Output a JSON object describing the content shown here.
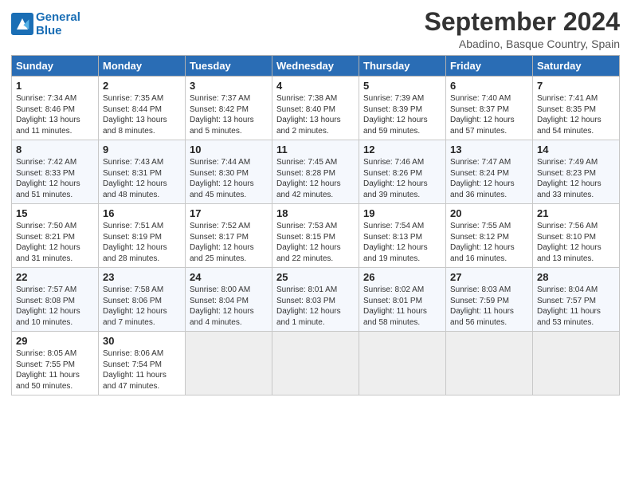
{
  "logo": {
    "line1": "General",
    "line2": "Blue"
  },
  "title": "September 2024",
  "location": "Abadino, Basque Country, Spain",
  "headers": [
    "Sunday",
    "Monday",
    "Tuesday",
    "Wednesday",
    "Thursday",
    "Friday",
    "Saturday"
  ],
  "weeks": [
    [
      {
        "num": "1",
        "info": "Sunrise: 7:34 AM\nSunset: 8:46 PM\nDaylight: 13 hours\nand 11 minutes."
      },
      {
        "num": "2",
        "info": "Sunrise: 7:35 AM\nSunset: 8:44 PM\nDaylight: 13 hours\nand 8 minutes."
      },
      {
        "num": "3",
        "info": "Sunrise: 7:37 AM\nSunset: 8:42 PM\nDaylight: 13 hours\nand 5 minutes."
      },
      {
        "num": "4",
        "info": "Sunrise: 7:38 AM\nSunset: 8:40 PM\nDaylight: 13 hours\nand 2 minutes."
      },
      {
        "num": "5",
        "info": "Sunrise: 7:39 AM\nSunset: 8:39 PM\nDaylight: 12 hours\nand 59 minutes."
      },
      {
        "num": "6",
        "info": "Sunrise: 7:40 AM\nSunset: 8:37 PM\nDaylight: 12 hours\nand 57 minutes."
      },
      {
        "num": "7",
        "info": "Sunrise: 7:41 AM\nSunset: 8:35 PM\nDaylight: 12 hours\nand 54 minutes."
      }
    ],
    [
      {
        "num": "8",
        "info": "Sunrise: 7:42 AM\nSunset: 8:33 PM\nDaylight: 12 hours\nand 51 minutes."
      },
      {
        "num": "9",
        "info": "Sunrise: 7:43 AM\nSunset: 8:31 PM\nDaylight: 12 hours\nand 48 minutes."
      },
      {
        "num": "10",
        "info": "Sunrise: 7:44 AM\nSunset: 8:30 PM\nDaylight: 12 hours\nand 45 minutes."
      },
      {
        "num": "11",
        "info": "Sunrise: 7:45 AM\nSunset: 8:28 PM\nDaylight: 12 hours\nand 42 minutes."
      },
      {
        "num": "12",
        "info": "Sunrise: 7:46 AM\nSunset: 8:26 PM\nDaylight: 12 hours\nand 39 minutes."
      },
      {
        "num": "13",
        "info": "Sunrise: 7:47 AM\nSunset: 8:24 PM\nDaylight: 12 hours\nand 36 minutes."
      },
      {
        "num": "14",
        "info": "Sunrise: 7:49 AM\nSunset: 8:23 PM\nDaylight: 12 hours\nand 33 minutes."
      }
    ],
    [
      {
        "num": "15",
        "info": "Sunrise: 7:50 AM\nSunset: 8:21 PM\nDaylight: 12 hours\nand 31 minutes."
      },
      {
        "num": "16",
        "info": "Sunrise: 7:51 AM\nSunset: 8:19 PM\nDaylight: 12 hours\nand 28 minutes."
      },
      {
        "num": "17",
        "info": "Sunrise: 7:52 AM\nSunset: 8:17 PM\nDaylight: 12 hours\nand 25 minutes."
      },
      {
        "num": "18",
        "info": "Sunrise: 7:53 AM\nSunset: 8:15 PM\nDaylight: 12 hours\nand 22 minutes."
      },
      {
        "num": "19",
        "info": "Sunrise: 7:54 AM\nSunset: 8:13 PM\nDaylight: 12 hours\nand 19 minutes."
      },
      {
        "num": "20",
        "info": "Sunrise: 7:55 AM\nSunset: 8:12 PM\nDaylight: 12 hours\nand 16 minutes."
      },
      {
        "num": "21",
        "info": "Sunrise: 7:56 AM\nSunset: 8:10 PM\nDaylight: 12 hours\nand 13 minutes."
      }
    ],
    [
      {
        "num": "22",
        "info": "Sunrise: 7:57 AM\nSunset: 8:08 PM\nDaylight: 12 hours\nand 10 minutes."
      },
      {
        "num": "23",
        "info": "Sunrise: 7:58 AM\nSunset: 8:06 PM\nDaylight: 12 hours\nand 7 minutes."
      },
      {
        "num": "24",
        "info": "Sunrise: 8:00 AM\nSunset: 8:04 PM\nDaylight: 12 hours\nand 4 minutes."
      },
      {
        "num": "25",
        "info": "Sunrise: 8:01 AM\nSunset: 8:03 PM\nDaylight: 12 hours\nand 1 minute."
      },
      {
        "num": "26",
        "info": "Sunrise: 8:02 AM\nSunset: 8:01 PM\nDaylight: 11 hours\nand 58 minutes."
      },
      {
        "num": "27",
        "info": "Sunrise: 8:03 AM\nSunset: 7:59 PM\nDaylight: 11 hours\nand 56 minutes."
      },
      {
        "num": "28",
        "info": "Sunrise: 8:04 AM\nSunset: 7:57 PM\nDaylight: 11 hours\nand 53 minutes."
      }
    ],
    [
      {
        "num": "29",
        "info": "Sunrise: 8:05 AM\nSunset: 7:55 PM\nDaylight: 11 hours\nand 50 minutes."
      },
      {
        "num": "30",
        "info": "Sunrise: 8:06 AM\nSunset: 7:54 PM\nDaylight: 11 hours\nand 47 minutes."
      },
      {
        "num": "",
        "info": "",
        "empty": true
      },
      {
        "num": "",
        "info": "",
        "empty": true
      },
      {
        "num": "",
        "info": "",
        "empty": true
      },
      {
        "num": "",
        "info": "",
        "empty": true
      },
      {
        "num": "",
        "info": "",
        "empty": true
      }
    ]
  ]
}
